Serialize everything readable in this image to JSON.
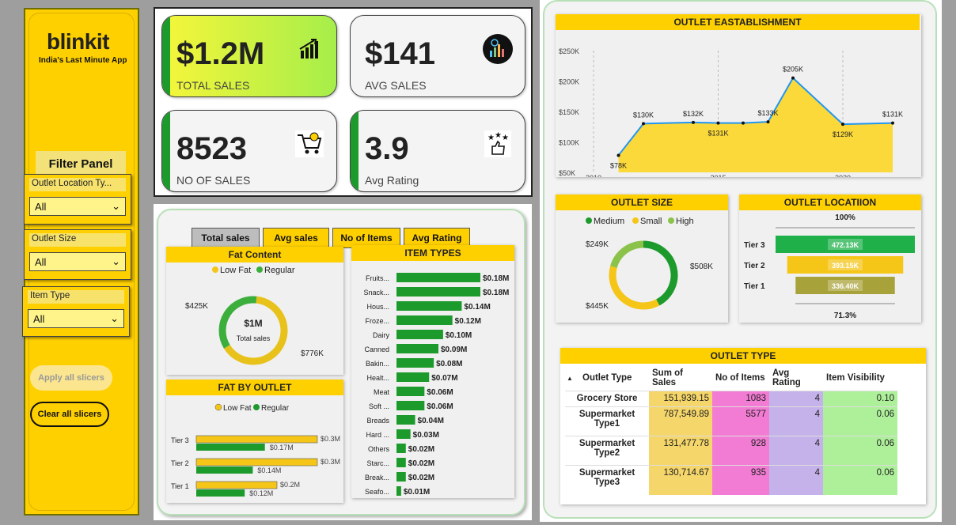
{
  "sidebar": {
    "logo": "blinkit",
    "tagline": "India's Last Minute App",
    "filter_title": "Filter Panel",
    "slicers": [
      {
        "label": "Outlet Location Ty...",
        "value": "All"
      },
      {
        "label": "Outlet Size",
        "value": "All"
      },
      {
        "label": "Item Type",
        "value": "All"
      }
    ],
    "apply_label": "Apply all slicers",
    "clear_label": "Clear all slicers"
  },
  "kpis": [
    {
      "value": "$1.2M",
      "caption": "TOTAL SALES",
      "icon": "chart-up-icon"
    },
    {
      "value": "$141",
      "caption": "AVG SALES",
      "icon": "coin-chart-icon"
    },
    {
      "value": "8523",
      "caption": "NO OF SALES",
      "icon": "cart-icon"
    },
    {
      "value": "3.9",
      "caption": "Avg Rating",
      "icon": "rating-stars-icon"
    }
  ],
  "tabs": [
    "Total sales",
    "Avg sales",
    "No of Items",
    "Avg Rating"
  ],
  "colors": {
    "yellow": "#ffd000",
    "green": "#1d9a2c",
    "light_green": "#8bc34a",
    "accent_yellow": "#f5c518"
  },
  "fat_content": {
    "title": "Fat Content",
    "legend": [
      "Low Fat",
      "Regular"
    ],
    "center_value": "$1M",
    "center_label": "Total sales",
    "label_regular": "$425K",
    "label_lowfat": "$776K",
    "chart_data": {
      "type": "pie",
      "categories": [
        "Low Fat",
        "Regular"
      ],
      "values": [
        776,
        425
      ]
    }
  },
  "item_types": {
    "title": "ITEM TYPES",
    "chart_data": {
      "type": "bar",
      "categories": [
        "Fruits...",
        "Snack...",
        "Hous...",
        "Froze...",
        "Dairy",
        "Canned",
        "Bakin...",
        "Healt...",
        "Meat",
        "Soft ...",
        "Breads",
        "Hard ...",
        "Others",
        "Starc...",
        "Break...",
        "Seafo..."
      ],
      "values": [
        0.18,
        0.18,
        0.14,
        0.12,
        0.1,
        0.09,
        0.08,
        0.07,
        0.06,
        0.06,
        0.04,
        0.03,
        0.02,
        0.02,
        0.02,
        0.01
      ],
      "labels": [
        "$0.18M",
        "$0.18M",
        "$0.14M",
        "$0.12M",
        "$0.10M",
        "$0.09M",
        "$0.08M",
        "$0.07M",
        "$0.06M",
        "$0.06M",
        "$0.04M",
        "$0.03M",
        "$0.02M",
        "$0.02M",
        "$0.02M",
        "$0.01M"
      ]
    }
  },
  "fat_by_outlet": {
    "title": "FAT BY OUTLET",
    "legend": [
      "Low Fat",
      "Regular"
    ],
    "chart_data": {
      "type": "bar",
      "categories": [
        "Tier 3",
        "Tier 2",
        "Tier 1"
      ],
      "series": [
        {
          "name": "Low Fat",
          "values": [
            0.3,
            0.3,
            0.2
          ],
          "labels": [
            "$0.3M",
            "$0.3M",
            "$0.2M"
          ]
        },
        {
          "name": "Regular",
          "values": [
            0.17,
            0.14,
            0.12
          ],
          "labels": [
            "$0.17M",
            "$0.14M",
            "$0.12M"
          ]
        }
      ]
    }
  },
  "establishment": {
    "title": "OUTLET EASTABLISHMENT",
    "chart_data": {
      "type": "area",
      "x": [
        2011,
        2012,
        2014,
        2015,
        2016,
        2017,
        2018,
        2020,
        2022
      ],
      "y": [
        78,
        130,
        132,
        131,
        131,
        133,
        205,
        129,
        131
      ],
      "labels": [
        "$78K",
        "$130K",
        "$132K",
        "$131K",
        "",
        "$133K",
        "$205K",
        "$129K",
        "$131K"
      ],
      "y_ticks": [
        "$50K",
        "$100K",
        "$150K",
        "$200K",
        "$250K"
      ],
      "x_ticks": [
        "2010",
        "2015",
        "2020"
      ],
      "ylim": [
        50,
        250
      ]
    }
  },
  "outlet_size": {
    "title": "OUTLET SIZE",
    "legend": [
      "Medium",
      "Small",
      "High"
    ],
    "labels": [
      "$508K",
      "$445K",
      "$249K"
    ],
    "chart_data": {
      "type": "pie",
      "categories": [
        "Medium",
        "Small",
        "High"
      ],
      "values": [
        508,
        445,
        249
      ]
    }
  },
  "outlet_location": {
    "title": "OUTLET LOCATIION",
    "top_pct": "100%",
    "bottom_pct": "71.3%",
    "chart_data": {
      "type": "bar",
      "categories": [
        "Tier 3",
        "Tier 2",
        "Tier 1"
      ],
      "values": [
        472.13,
        393.15,
        336.4
      ],
      "labels": [
        "472.13K",
        "393.15K",
        "336.40K"
      ]
    }
  },
  "outlet_type": {
    "title": "OUTLET TYPE",
    "columns": [
      "Outlet Type",
      "Sum of Sales",
      "No of Items",
      "Avg Rating",
      "Item Visibility"
    ],
    "rows": [
      [
        "Grocery Store",
        "151,939.15",
        "1083",
        "4",
        "0.10"
      ],
      [
        "Supermarket Type1",
        "787,549.89",
        "5577",
        "4",
        "0.06"
      ],
      [
        "Supermarket Type2",
        "131,477.78",
        "928",
        "4",
        "0.06"
      ],
      [
        "Supermarket Type3",
        "130,714.67",
        "935",
        "4",
        "0.06"
      ]
    ]
  }
}
